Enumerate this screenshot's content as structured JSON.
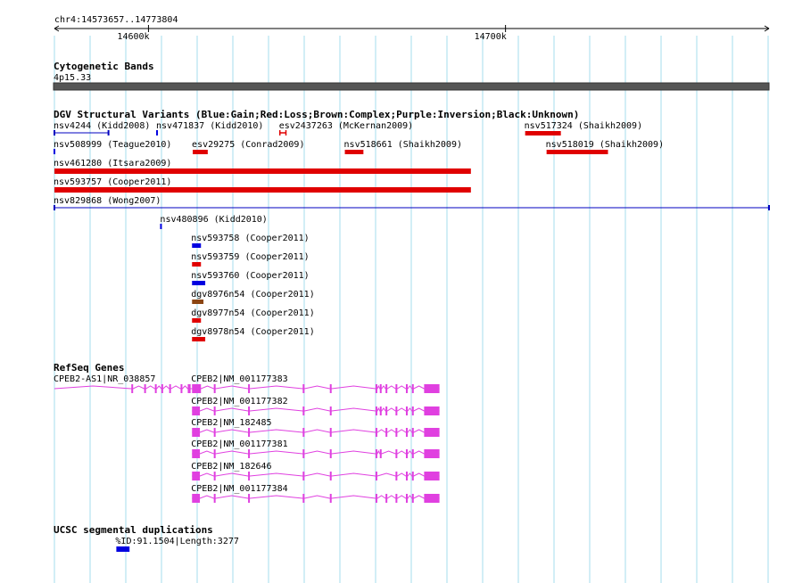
{
  "view": {
    "coord_label": "chr4:14573657..14773804",
    "start": 14573657,
    "end": 14773804,
    "ticks": [
      {
        "pos": 14600000,
        "label": "14600k"
      },
      {
        "pos": 14700000,
        "label": "14700k"
      }
    ],
    "colors": {
      "grid": "#a6dcec",
      "ruler": "#000000"
    }
  },
  "tracks": {
    "cytoband": {
      "title": "Cytogenetic Bands",
      "band_label": "4p15.33",
      "color": "#555555"
    },
    "dgv": {
      "title": "DGV Structural Variants (Blue:Gain;Red:Loss;Brown:Complex;Purple:Inversion;Black:Unknown)",
      "colors": {
        "gain": "#0000e0",
        "loss": "#e00000",
        "complex": "#8b4513",
        "blue_line": "#0000c0"
      },
      "features": [
        {
          "label": "nsv4244 (Kidd2008)",
          "start": 14573657,
          "end": 14588800,
          "type": "gain",
          "style": "line",
          "row": 0
        },
        {
          "label": "nsv471837 (Kidd2010)",
          "start": 14602400,
          "end": 14602700,
          "type": "gain",
          "style": "tick",
          "row": 0
        },
        {
          "label": "esv2437263 (McKernan2009)",
          "start": 14636800,
          "end": 14638500,
          "type": "loss",
          "style": "bracket",
          "row": 0
        },
        {
          "label": "nsv517324 (Shaikh2009)",
          "start": 14705500,
          "end": 14715500,
          "type": "loss",
          "style": "bar",
          "row": 0
        },
        {
          "label": "nsv508999 (Teague2010)",
          "start": 14573657,
          "end": 14574300,
          "type": "gain",
          "style": "tick",
          "row": 1
        },
        {
          "label": "esv29275 (Conrad2009)",
          "start": 14612400,
          "end": 14616600,
          "type": "loss",
          "style": "bar",
          "row": 1
        },
        {
          "label": "nsv518661 (Shaikh2009)",
          "start": 14655000,
          "end": 14660200,
          "type": "loss",
          "style": "bar",
          "row": 1
        },
        {
          "label": "nsv518019 (Shaikh2009)",
          "start": 14711500,
          "end": 14728700,
          "type": "loss",
          "style": "bar",
          "row": 1
        },
        {
          "label": "nsv461280 (Itsara2009)",
          "start": 14573657,
          "end": 14690300,
          "type": "loss",
          "style": "bar",
          "row": 2
        },
        {
          "label": "nsv593757 (Cooper2011)",
          "start": 14573657,
          "end": 14690300,
          "type": "loss",
          "style": "bar",
          "row": 3
        },
        {
          "label": "nsv829868 (Wong2007)",
          "start": 14573657,
          "end": 14773804,
          "type": "gain",
          "style": "line",
          "row": 4
        },
        {
          "label": "nsv480896 (Kidd2010)",
          "start": 14603500,
          "end": 14603900,
          "type": "gain",
          "style": "tick",
          "row": 5
        },
        {
          "label": "nsv593758 (Cooper2011)",
          "start": 14612200,
          "end": 14614700,
          "type": "gain",
          "style": "bar",
          "row": 6
        },
        {
          "label": "nsv593759 (Cooper2011)",
          "start": 14612200,
          "end": 14614700,
          "type": "loss",
          "style": "bar",
          "row": 7
        },
        {
          "label": "nsv593760 (Cooper2011)",
          "start": 14612200,
          "end": 14615900,
          "type": "gain",
          "style": "bar",
          "row": 8
        },
        {
          "label": "dgv8976n54 (Cooper2011)",
          "start": 14612200,
          "end": 14615400,
          "type": "complex",
          "style": "bar",
          "row": 9
        },
        {
          "label": "dgv8977n54 (Cooper2011)",
          "start": 14612200,
          "end": 14614700,
          "type": "loss",
          "style": "bar",
          "row": 10
        },
        {
          "label": "dgv8978n54 (Cooper2011)",
          "start": 14612200,
          "end": 14615900,
          "type": "loss",
          "style": "bar",
          "row": 11
        }
      ]
    },
    "refseq": {
      "title": "RefSeq Genes",
      "color": "#e040e0",
      "genes": [
        {
          "label": "CPEB2-AS1|NR_038857",
          "start": 14573657,
          "end": 14612200,
          "exons": [
            [
              14595200,
              14595700
            ],
            [
              14598800,
              14599300
            ],
            [
              14601800,
              14602300
            ],
            [
              14603600,
              14604100
            ],
            [
              14605800,
              14606300
            ],
            [
              14609000,
              14609500
            ],
            [
              14611000,
              14611800
            ]
          ],
          "row": 0
        },
        {
          "label": "CPEB2|NM_001177383",
          "start": 14612200,
          "end": 14681500,
          "exons": [
            [
              14612200,
              14614700
            ],
            [
              14618300,
              14618800
            ],
            [
              14627900,
              14628400
            ],
            [
              14643200,
              14643700
            ],
            [
              14650800,
              14651300
            ],
            [
              14663600,
              14664100
            ],
            [
              14664800,
              14665300
            ],
            [
              14666400,
              14666900
            ],
            [
              14669200,
              14669700
            ],
            [
              14672100,
              14672600
            ],
            [
              14673800,
              14674300
            ],
            [
              14677200,
              14681500
            ]
          ],
          "row": 0
        },
        {
          "label": "CPEB2|NM_001177382",
          "start": 14612200,
          "end": 14681500,
          "exons": [
            [
              14612200,
              14614400
            ],
            [
              14618300,
              14618800
            ],
            [
              14627900,
              14628400
            ],
            [
              14643200,
              14643700
            ],
            [
              14650800,
              14651300
            ],
            [
              14663600,
              14664100
            ],
            [
              14664800,
              14665300
            ],
            [
              14666400,
              14666900
            ],
            [
              14669200,
              14669700
            ],
            [
              14672100,
              14672600
            ],
            [
              14673800,
              14674300
            ],
            [
              14677200,
              14681500
            ]
          ],
          "row": 1
        },
        {
          "label": "CPEB2|NM_182485",
          "start": 14612200,
          "end": 14681500,
          "exons": [
            [
              14612200,
              14614400
            ],
            [
              14618300,
              14618800
            ],
            [
              14627900,
              14628400
            ],
            [
              14643200,
              14643700
            ],
            [
              14650800,
              14651300
            ],
            [
              14663600,
              14664100
            ],
            [
              14666400,
              14666900
            ],
            [
              14669200,
              14669700
            ],
            [
              14672100,
              14672600
            ],
            [
              14673800,
              14674300
            ],
            [
              14677200,
              14681500
            ]
          ],
          "row": 2
        },
        {
          "label": "CPEB2|NM_001177381",
          "start": 14612200,
          "end": 14681500,
          "exons": [
            [
              14612200,
              14614400
            ],
            [
              14618300,
              14618800
            ],
            [
              14627900,
              14628400
            ],
            [
              14643200,
              14643700
            ],
            [
              14650800,
              14651300
            ],
            [
              14663600,
              14664100
            ],
            [
              14664800,
              14665300
            ],
            [
              14669200,
              14669700
            ],
            [
              14672100,
              14672600
            ],
            [
              14673800,
              14674300
            ],
            [
              14677200,
              14681500
            ]
          ],
          "row": 3
        },
        {
          "label": "CPEB2|NM_182646",
          "start": 14612200,
          "end": 14681500,
          "exons": [
            [
              14612200,
              14614400
            ],
            [
              14618300,
              14618800
            ],
            [
              14627900,
              14628400
            ],
            [
              14643200,
              14643700
            ],
            [
              14650800,
              14651300
            ],
            [
              14663600,
              14664100
            ],
            [
              14669200,
              14669700
            ],
            [
              14672100,
              14672600
            ],
            [
              14673800,
              14674300
            ],
            [
              14677200,
              14681500
            ]
          ],
          "row": 4
        },
        {
          "label": "CPEB2|NM_001177384",
          "start": 14612200,
          "end": 14681500,
          "exons": [
            [
              14612200,
              14614400
            ],
            [
              14618300,
              14618800
            ],
            [
              14627900,
              14628400
            ],
            [
              14643200,
              14643700
            ],
            [
              14650800,
              14651300
            ],
            [
              14663600,
              14664100
            ],
            [
              14666400,
              14666900
            ],
            [
              14669200,
              14669700
            ],
            [
              14672100,
              14672600
            ],
            [
              14673800,
              14674300
            ],
            [
              14677200,
              14681500
            ]
          ],
          "row": 5
        }
      ]
    },
    "segdup": {
      "title": "UCSC segmental duplications",
      "color": "#0000e0",
      "features": [
        {
          "label": "%ID:91.1504|Length:3277",
          "start": 14591000,
          "end": 14594700
        }
      ]
    }
  }
}
